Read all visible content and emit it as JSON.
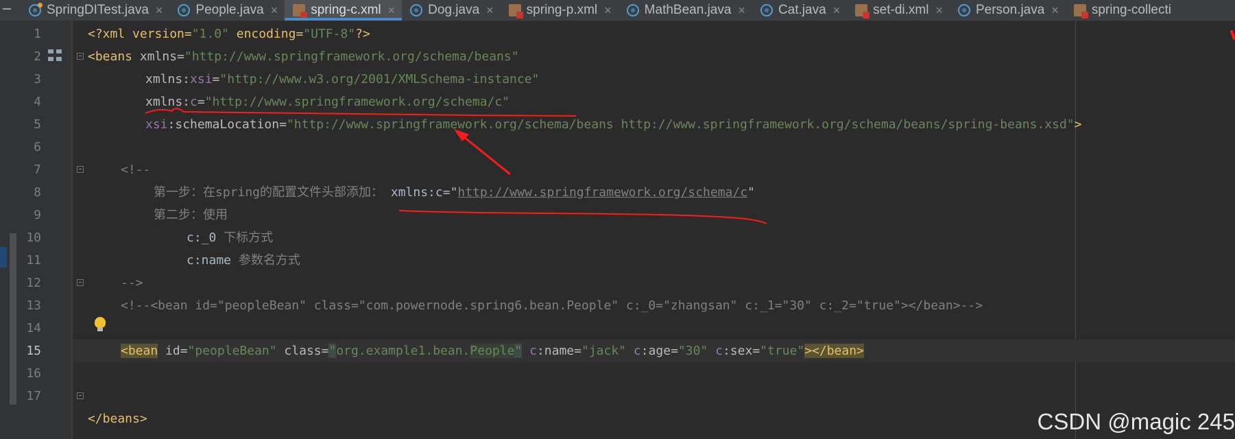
{
  "tabs": [
    {
      "label": "SpringDITest.java",
      "type": "java-test"
    },
    {
      "label": "People.java",
      "type": "java"
    },
    {
      "label": "spring-c.xml",
      "type": "xml",
      "active": true
    },
    {
      "label": "Dog.java",
      "type": "java"
    },
    {
      "label": "spring-p.xml",
      "type": "xml"
    },
    {
      "label": "MathBean.java",
      "type": "java"
    },
    {
      "label": "Cat.java",
      "type": "java"
    },
    {
      "label": "set-di.xml",
      "type": "xml"
    },
    {
      "label": "Person.java",
      "type": "java"
    },
    {
      "label": "spring-collecti",
      "type": "xml"
    }
  ],
  "close_glyph": "×",
  "line_numbers": [
    "1",
    "2",
    "3",
    "4",
    "5",
    "6",
    "7",
    "8",
    "9",
    "10",
    "11",
    "12",
    "13",
    "14",
    "15",
    "16",
    "17"
  ],
  "current_line": 15,
  "code": {
    "l1": {
      "open": "<?xml version=",
      "v1": "\"1.0\"",
      "mid": " encoding=",
      "v2": "\"UTF-8\"",
      "close": "?>"
    },
    "l2": {
      "tag": "<beans",
      "attr": " xmlns",
      "eq": "=",
      "val": "\"http://www.springframework.org/schema/beans\""
    },
    "l3": {
      "attr": "xmlns:",
      "ns": "xsi",
      "eq": "=",
      "val": "\"http://www.w3.org/2001/XMLSchema-instance\""
    },
    "l4": {
      "attr": "xmlns:",
      "ns": "c",
      "eq": "=",
      "val": "\"http://www.springframework.org/schema/c\""
    },
    "l5": {
      "ns": "xsi",
      "attr": ":schemaLocation",
      "eq": "=",
      "val": "\"http://www.springframework.org/schema/beans http://www.springframework.org/schema/beans/spring-beans.xsd\"",
      "close": ">"
    },
    "l7": "<!--",
    "l8": {
      "cjk": "第一步：在",
      "w1": "spring",
      "cjk2": "的配置文件头部添加：",
      "code": " xmlns:c=\"",
      "url": "http://www.springframework.org/schema/c",
      "end": "\""
    },
    "l9": "第二步：使用",
    "l10": {
      "code": "c:_0 ",
      "cjk": "下标方式"
    },
    "l11": {
      "code": "c:name ",
      "cjk": "参数名方式"
    },
    "l12": "-->",
    "l13": "<!--<bean id=\"peopleBean\" class=\"com.powernode.spring6.bean.People\" c:_0=\"zhangsan\" c:_1=\"30\" c:_2=\"true\"></bean>-->",
    "l15": {
      "tag": "<bean",
      "a1": " id",
      "v1": "\"peopleBean\"",
      "a2": " class",
      "q": "\"",
      "v2a": "org.example1.bean.",
      "v2b": "People",
      "ns1": " c",
      "a3": ":name",
      "v3": "\"jack\"",
      "ns2": " c",
      "a4": ":age",
      "v4": "\"30\"",
      "ns3": " c",
      "a5": ":sex",
      "v5": "\"true\"",
      "close": "></bean>"
    },
    "l17": "</beans>",
    "eq": "="
  },
  "watermark": "CSDN @magic 245",
  "colors": {
    "annotation": "#ff1a1a",
    "tag": "#e8bf6a",
    "string": "#6a8759",
    "namespace": "#9876aa",
    "comment": "#808080"
  }
}
